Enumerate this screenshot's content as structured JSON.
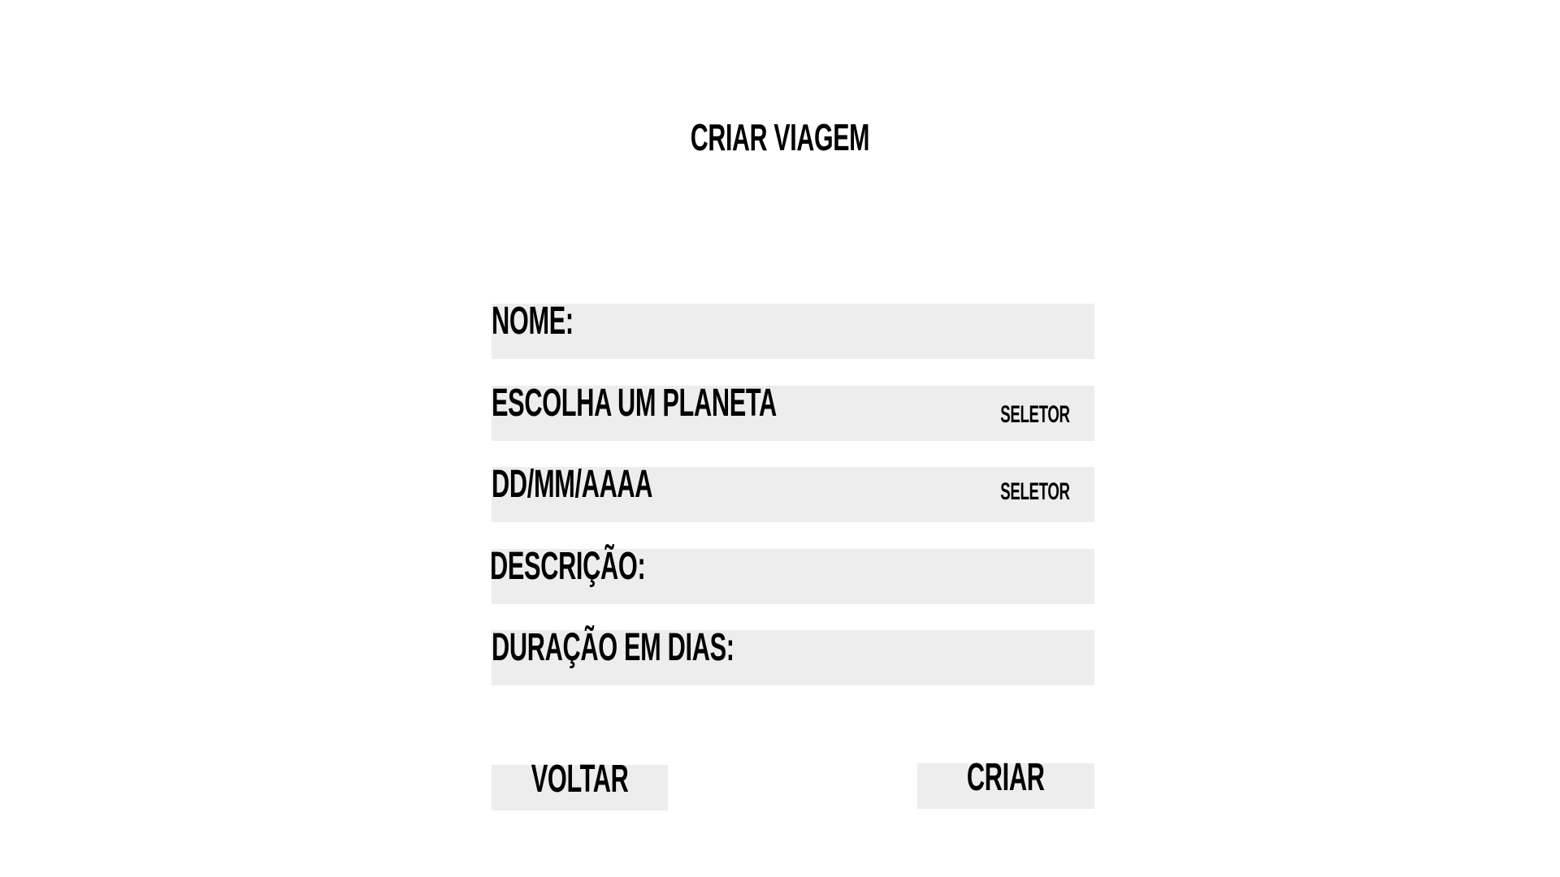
{
  "title": "CRIAR VIAGEM",
  "form": {
    "nome_label": "NOME:",
    "planeta_label": "ESCOLHA UM PLANETA",
    "planeta_selector": "SELETOR",
    "data_label": "DD/MM/AAAA",
    "data_selector": "SELETOR",
    "descricao_label": "DESCRIÇÃO:",
    "duracao_label": "DURAÇÃO EM DIAS:"
  },
  "buttons": {
    "back_label": "VOLTAR",
    "create_label": "CRIAR"
  },
  "colors": {
    "field_background": "#ededed",
    "text": "#000000",
    "page_background": "#ffffff"
  }
}
